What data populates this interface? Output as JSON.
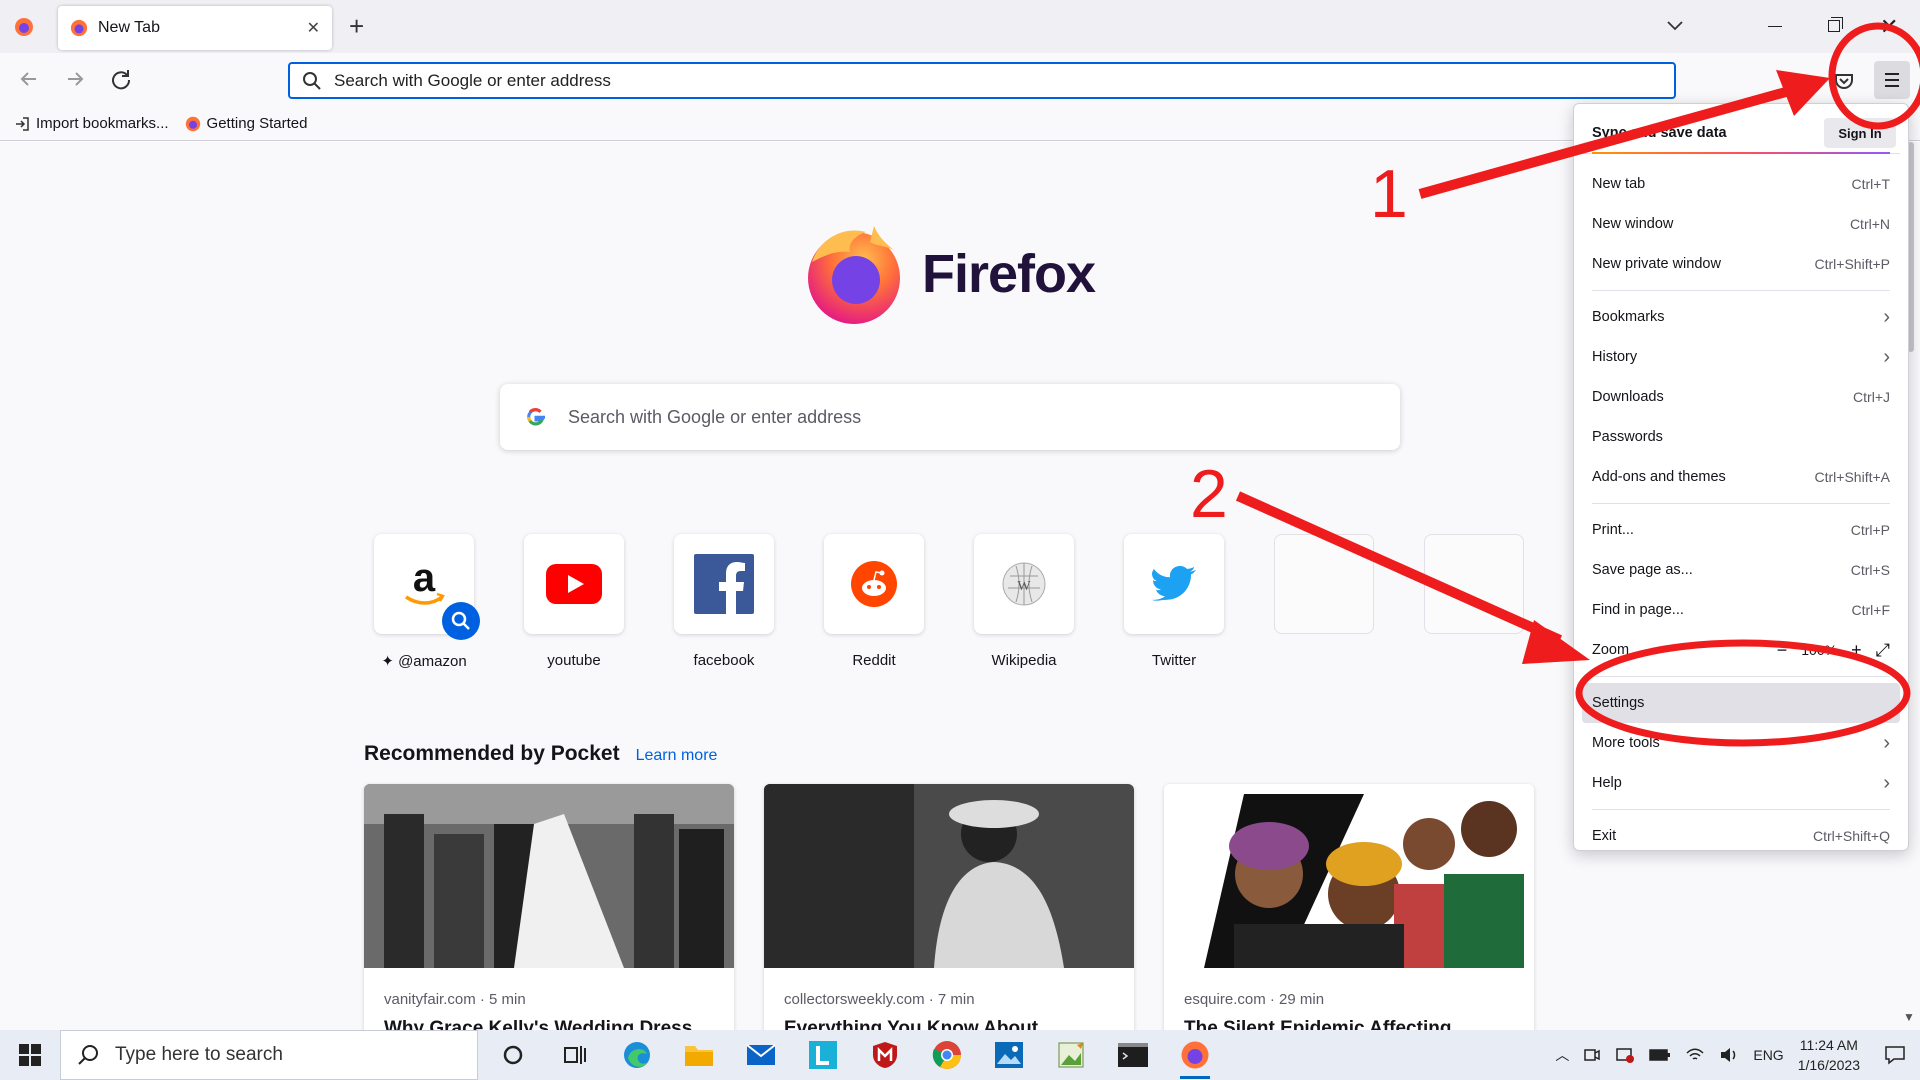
{
  "browser": {
    "tab": {
      "title": "New Tab"
    },
    "urlbar": {
      "placeholder": "Search with Google or enter address"
    },
    "bookmarks": [
      {
        "label": "Import bookmarks...",
        "icon": "import-icon"
      },
      {
        "label": "Getting Started",
        "icon": "firefox-icon"
      }
    ]
  },
  "newtab": {
    "wordmark": "Firefox",
    "search_placeholder": "Search with Google or enter address",
    "shortcuts": [
      {
        "label": "@amazon",
        "icon": "amazon-icon"
      },
      {
        "label": "youtube",
        "icon": "youtube-icon"
      },
      {
        "label": "facebook",
        "icon": "facebook-icon"
      },
      {
        "label": "Reddit",
        "icon": "reddit-icon"
      },
      {
        "label": "Wikipedia",
        "icon": "wikipedia-icon"
      },
      {
        "label": "Twitter",
        "icon": "twitter-icon"
      }
    ],
    "pocket": {
      "heading": "Recommended by Pocket",
      "learn_more": "Learn more",
      "cards": [
        {
          "source": "vanityfair.com · 5 min",
          "title": "Why Grace Kelly's Wedding Dress"
        },
        {
          "source": "collectorsweekly.com · 7 min",
          "title": "Everything You Know About"
        },
        {
          "source": "esquire.com · 29 min",
          "title": "The Silent Epidemic Affecting"
        }
      ]
    }
  },
  "app_menu": {
    "sync": {
      "label": "Sync and save data",
      "button": "Sign In"
    },
    "items": [
      {
        "label": "New tab",
        "shortcut": "Ctrl+T"
      },
      {
        "label": "New window",
        "shortcut": "Ctrl+N"
      },
      {
        "label": "New private window",
        "shortcut": "Ctrl+Shift+P"
      },
      {
        "label": "Bookmarks",
        "shortcut": ""
      },
      {
        "label": "History",
        "shortcut": ""
      },
      {
        "label": "Downloads",
        "shortcut": "Ctrl+J"
      },
      {
        "label": "Passwords",
        "shortcut": ""
      },
      {
        "label": "Add-ons and themes",
        "shortcut": "Ctrl+Shift+A"
      },
      {
        "label": "Print...",
        "shortcut": "Ctrl+P"
      },
      {
        "label": "Save page as...",
        "shortcut": "Ctrl+S"
      },
      {
        "label": "Find in page...",
        "shortcut": "Ctrl+F"
      },
      {
        "label": "Zoom",
        "shortcut": ""
      },
      {
        "label": "Settings",
        "shortcut": ""
      },
      {
        "label": "More tools",
        "shortcut": ""
      },
      {
        "label": "Help",
        "shortcut": ""
      },
      {
        "label": "Exit",
        "shortcut": "Ctrl+Shift+Q"
      }
    ],
    "zoom_value": "100%"
  },
  "annotations": {
    "step1": "1",
    "step2": "2"
  },
  "taskbar": {
    "search_placeholder": "Type here to search",
    "language": "ENG",
    "time": "11:24 AM",
    "date": "1/16/2023"
  },
  "colors": {
    "accent": "#0061e0",
    "annotation": "#ee1c1c",
    "firefox_wordmark": "#20123a"
  }
}
